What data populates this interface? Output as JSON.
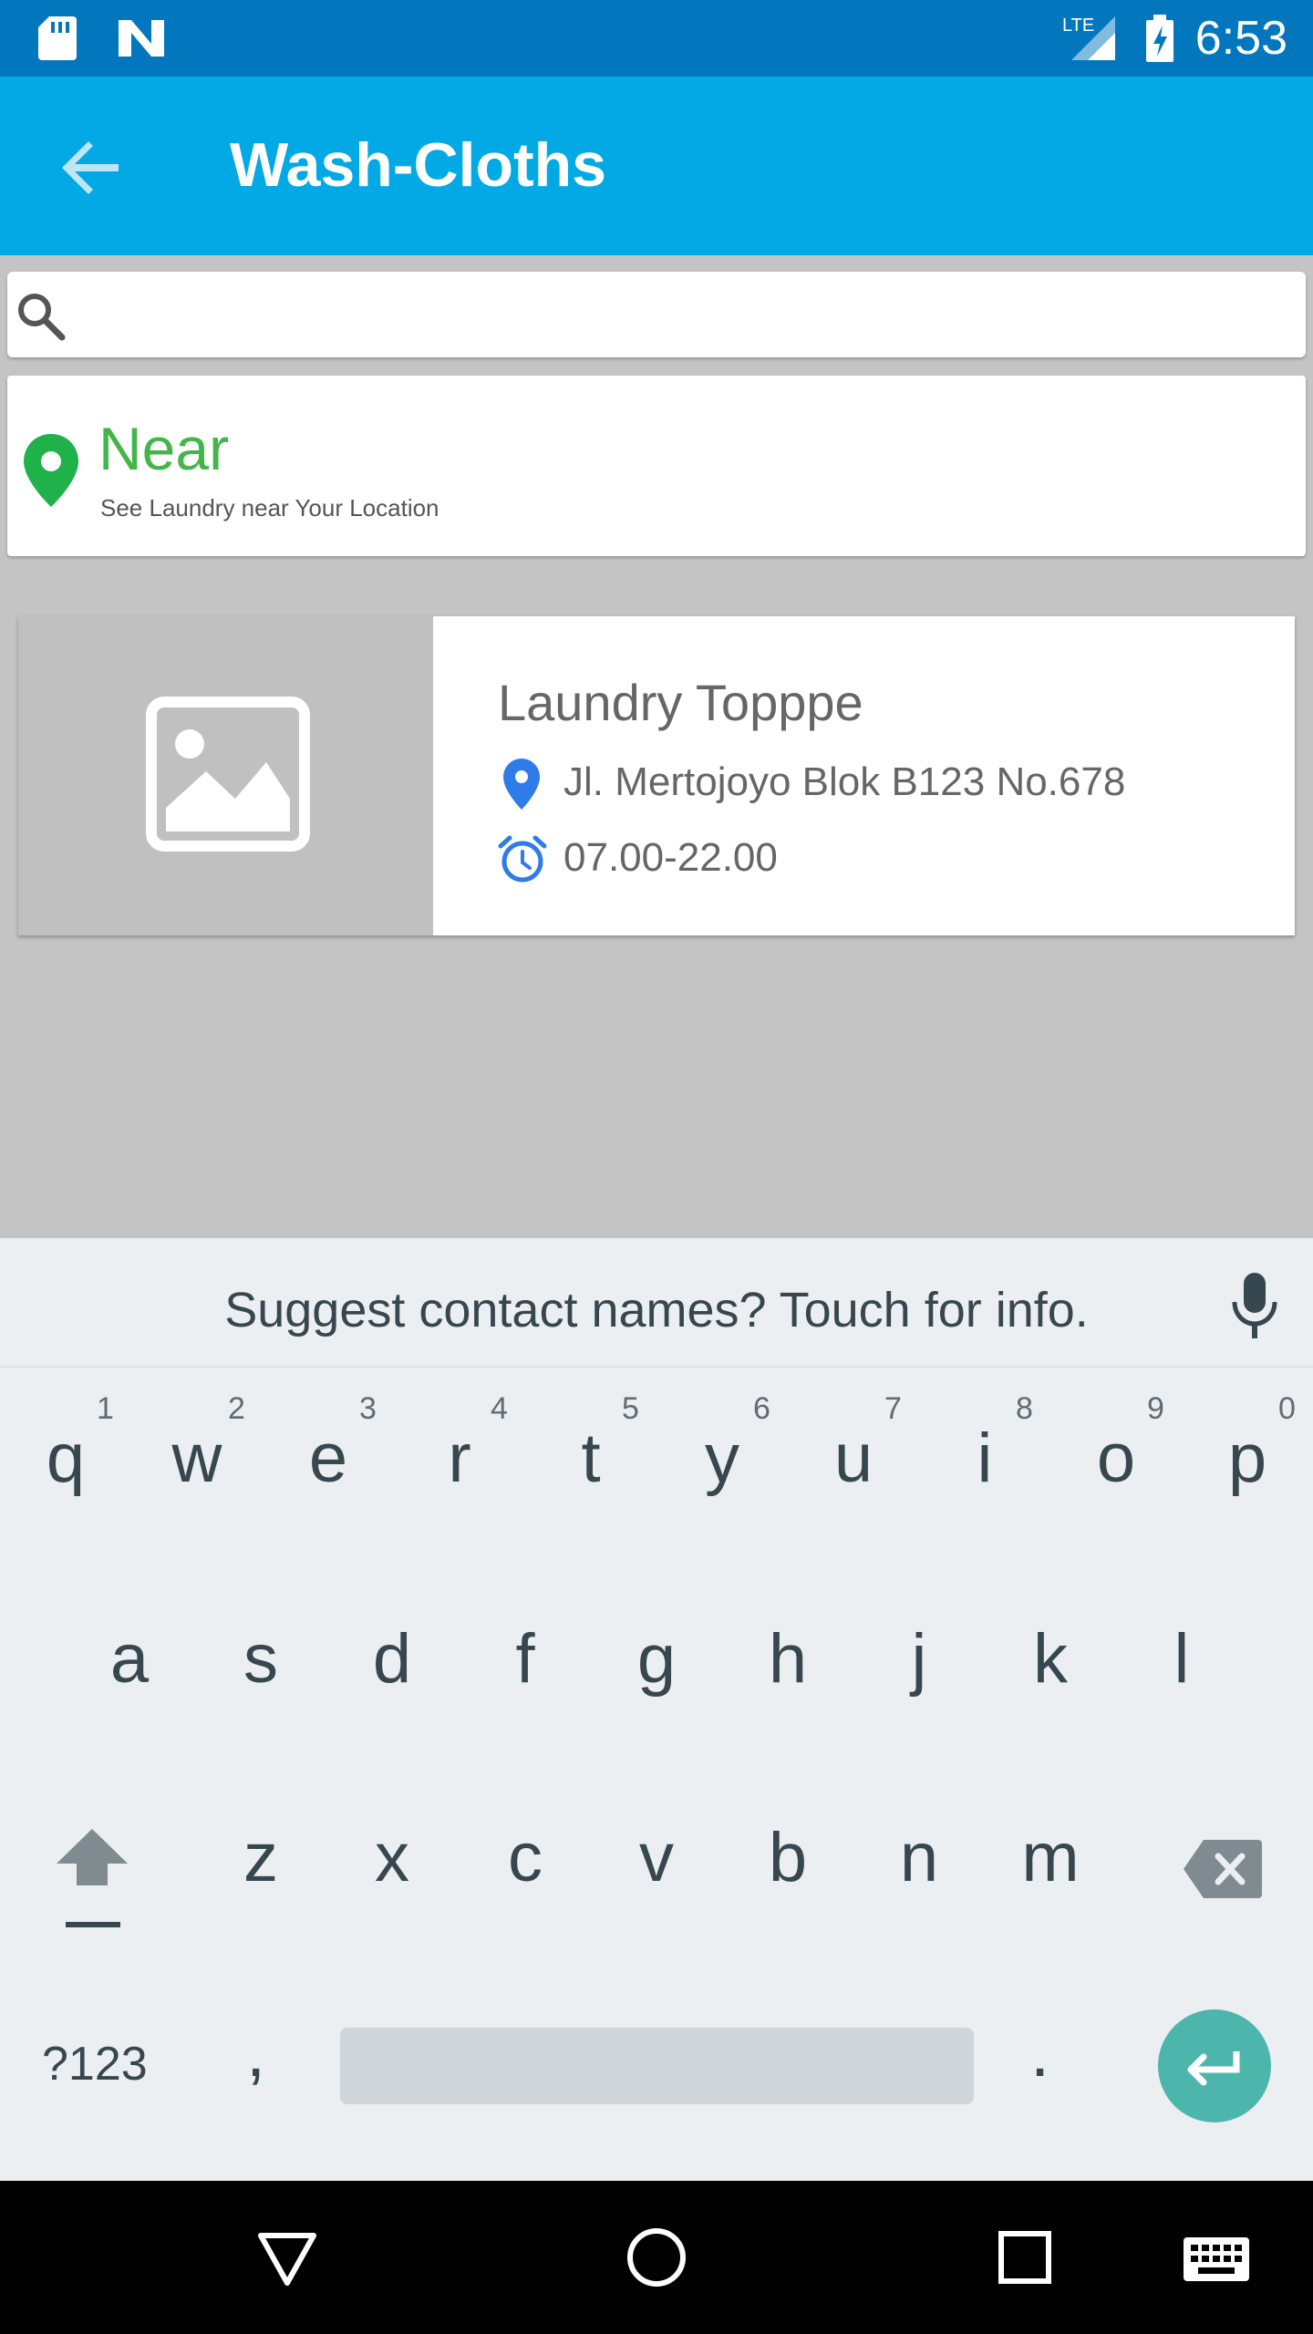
{
  "status_bar": {
    "time": "6:53",
    "network_label": "LTE",
    "icons": [
      "sd-card-icon",
      "n-logo-icon",
      "signal-icon",
      "battery-icon"
    ]
  },
  "app_bar": {
    "title": "Wash-Cloths",
    "back_icon": "arrow-back-icon",
    "background": "#03a9e4"
  },
  "search": {
    "icon": "search-icon",
    "value": "",
    "placeholder": ""
  },
  "near": {
    "title": "Near",
    "subtitle": "See Laundry near Your Location",
    "color": "#43b549"
  },
  "laundry_list": [
    {
      "name": "Laundry Topppe",
      "address": "Jl. Mertojoyo Blok B123 No.678",
      "hours": "07.00-22.00"
    }
  ],
  "keyboard": {
    "suggestion": "Suggest contact names? Touch for info.",
    "row1": [
      {
        "key": "q",
        "hint": "1"
      },
      {
        "key": "w",
        "hint": "2"
      },
      {
        "key": "e",
        "hint": "3"
      },
      {
        "key": "r",
        "hint": "4"
      },
      {
        "key": "t",
        "hint": "5"
      },
      {
        "key": "y",
        "hint": "6"
      },
      {
        "key": "u",
        "hint": "7"
      },
      {
        "key": "i",
        "hint": "8"
      },
      {
        "key": "o",
        "hint": "9"
      },
      {
        "key": "p",
        "hint": "0"
      }
    ],
    "row2": [
      "a",
      "s",
      "d",
      "f",
      "g",
      "h",
      "j",
      "k",
      "l"
    ],
    "row3": [
      "z",
      "x",
      "c",
      "v",
      "b",
      "n",
      "m"
    ],
    "symbols_label": "?123",
    "comma": ",",
    "period": ".",
    "enter_color": "#4db6ac"
  },
  "nav_bar": {
    "buttons": [
      "back-triangle-icon",
      "home-circle-icon",
      "recents-square-icon",
      "keyboard-icon"
    ]
  }
}
